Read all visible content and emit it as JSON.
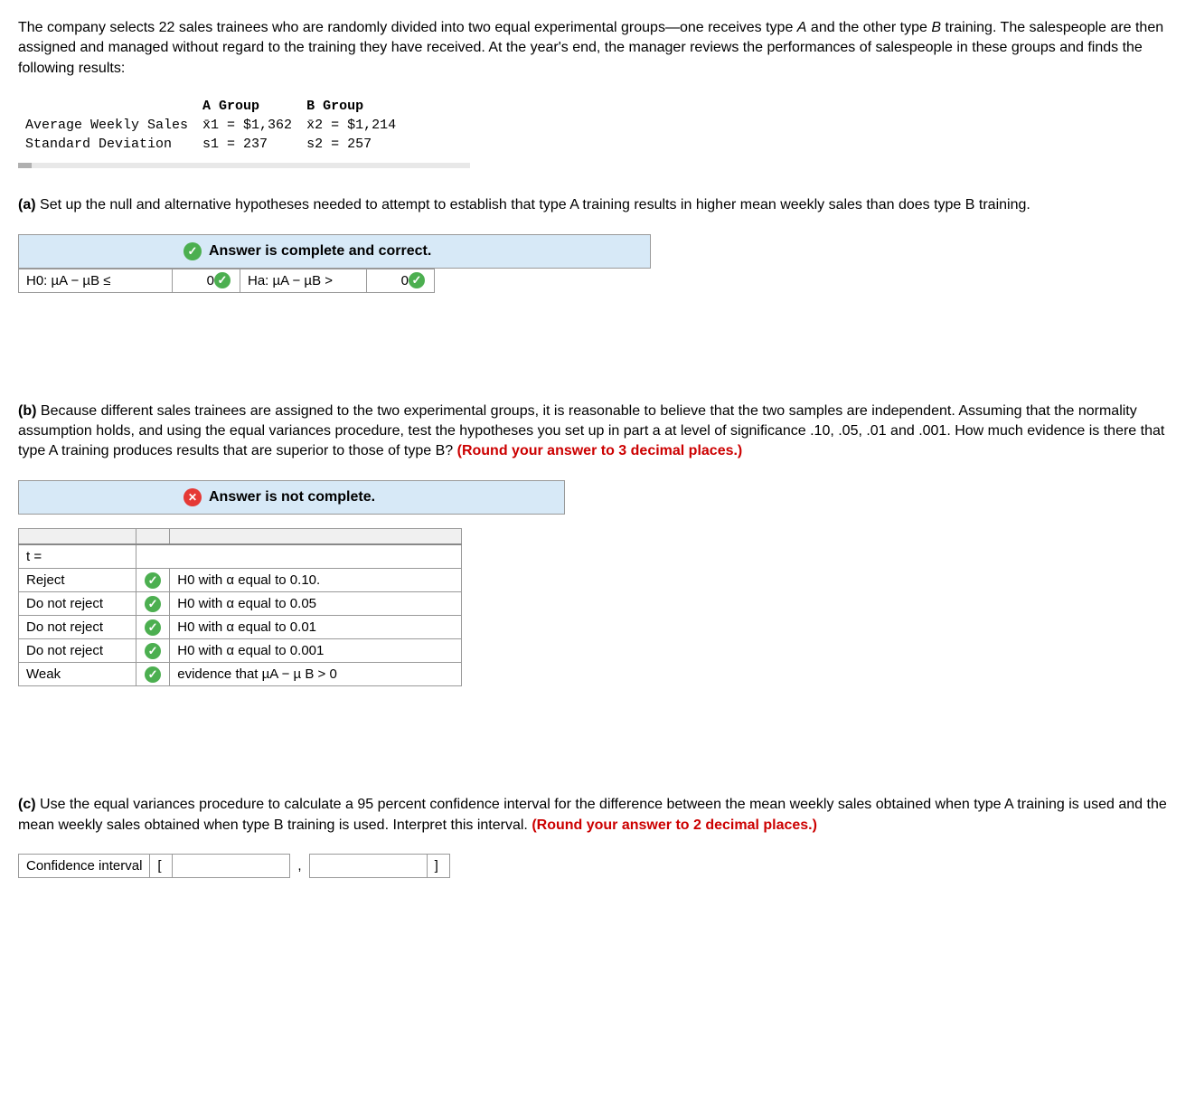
{
  "intro": "The company selects 22 sales trainees who are randomly divided into two equal experimental groups—one receives type A and the other type B training. The salespeople are then assigned and managed without regard to the training they have received. At the year's end, the manager reviews the performances of salespeople in these groups and finds the following results:",
  "data_table": {
    "col_a": "A Group",
    "col_b": "B Group",
    "row1_label": "Average Weekly Sales",
    "row1_a": "x̄1 = $1,362",
    "row1_b": "x̄2 = $1,214",
    "row2_label": "Standard Deviation",
    "row2_a": "s1 = 237",
    "row2_b": "s2 = 257"
  },
  "part_a": {
    "label": "(a)",
    "text": "Set up the null and alternative hypotheses needed to attempt to establish that type A training results in higher mean weekly sales than does type B training.",
    "banner": "Answer is complete and correct.",
    "h0_label": "H0: µA − µB ≤",
    "h0_value": "0",
    "ha_label": "Ha: µA − µB >",
    "ha_value": "0"
  },
  "part_b": {
    "label": "(b)",
    "text": "Because different sales trainees are assigned to the two experimental groups, it is reasonable to believe that the two samples are independent. Assuming that the normality assumption holds, and using the equal variances procedure, test the hypotheses you set up in part a at level of significance .10, .05, .01 and .001. How much evidence is there that type A training produces results that are superior to those of type B?",
    "round_text": "(Round your answer to 3 decimal places.)",
    "banner": "Answer is not complete.",
    "t_label": "t =",
    "rows": [
      {
        "col1": "Reject",
        "col2": "H0 with α equal to 0.10."
      },
      {
        "col1": "Do not reject",
        "col2": "H0 with α equal to 0.05"
      },
      {
        "col1": "Do not reject",
        "col2": "H0 with α equal to 0.01"
      },
      {
        "col1": "Do not reject",
        "col2": "H0 with α equal to 0.001"
      },
      {
        "col1": "Weak",
        "col2": "evidence that µA − µ B > 0"
      }
    ]
  },
  "part_c": {
    "label": "(c)",
    "text": "Use the equal variances procedure to calculate a 95 percent confidence interval for the difference between the mean weekly sales obtained when type A training is used and the mean weekly sales obtained when type B training is used. Interpret this interval.",
    "round_text": "(Round your answer to 2 decimal places.)",
    "ci_label": "Confidence interval",
    "bracket_open": "[",
    "comma": ",",
    "bracket_close": "]"
  }
}
